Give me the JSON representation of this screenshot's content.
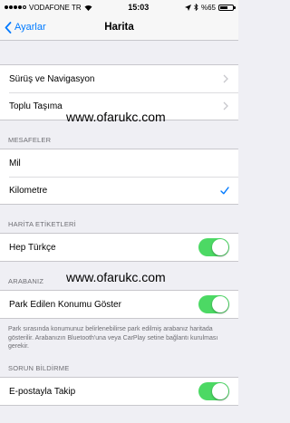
{
  "status_bar": {
    "carrier": "VODAFONE TR",
    "time": "15:03",
    "battery_text": "%65",
    "battery_level": 0.65
  },
  "nav": {
    "back_label": "Ayarlar",
    "title": "Harita"
  },
  "group1": {
    "items": [
      {
        "label": "Sürüş ve Navigasyon"
      },
      {
        "label": "Toplu Taşıma"
      }
    ]
  },
  "distances": {
    "header": "MESAFELER",
    "items": [
      {
        "label": "Mil",
        "selected": false
      },
      {
        "label": "Kilometre",
        "selected": true
      }
    ]
  },
  "map_labels": {
    "header": "HARİTA ETİKETLERİ",
    "items": [
      {
        "label": "Hep Türkçe",
        "on": true
      }
    ]
  },
  "car": {
    "header": "ARABANIZ",
    "items": [
      {
        "label": "Park Edilen Konumu Göster",
        "on": true
      }
    ],
    "footer": "Park sırasında konumunuz belirlenebilirse park edilmiş arabanız haritada gösterilir. Arabanızın Bluetooth'una veya CarPlay setine bağlantı kurulması gerekir."
  },
  "problem": {
    "header": "SORUN BİLDİRME",
    "items": [
      {
        "label": "E-postayla Takip",
        "on": true
      }
    ]
  },
  "watermarks": [
    "www.ofarukc.com",
    "www.ofarukc.com"
  ],
  "colors": {
    "accent": "#007aff",
    "toggle_on": "#4cd964",
    "background": "#efeff4"
  }
}
